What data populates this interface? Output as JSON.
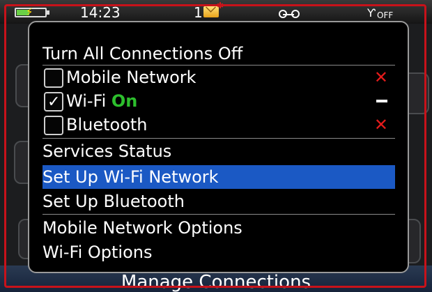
{
  "status_bar": {
    "time": "14:23",
    "message_count": "1",
    "signal_status": "OFF",
    "battery_level_pct": 45
  },
  "background": {
    "screen_title": "Manage Connections"
  },
  "menu": {
    "items": [
      {
        "label": "Turn All Connections Off"
      },
      {
        "label": "Mobile Network",
        "checked": false,
        "status": "x"
      },
      {
        "label": "Wi-Fi",
        "checked": true,
        "state_label": "On",
        "status": "dash"
      },
      {
        "label": "Bluetooth",
        "checked": false,
        "status": "x"
      },
      {
        "label": "Services Status"
      },
      {
        "label": "Set Up Wi-Fi Network",
        "selected": true
      },
      {
        "label": "Set Up Bluetooth"
      },
      {
        "label": "Mobile Network Options"
      },
      {
        "label": "Wi-Fi Options"
      }
    ],
    "status_glyphs": {
      "x": "✕",
      "check": "✓"
    }
  },
  "colors": {
    "selection": "#1b59c4",
    "on_green": "#2dbf2d",
    "disabled_red": "#e41b1b",
    "device_frame_red": "#c8121a"
  }
}
